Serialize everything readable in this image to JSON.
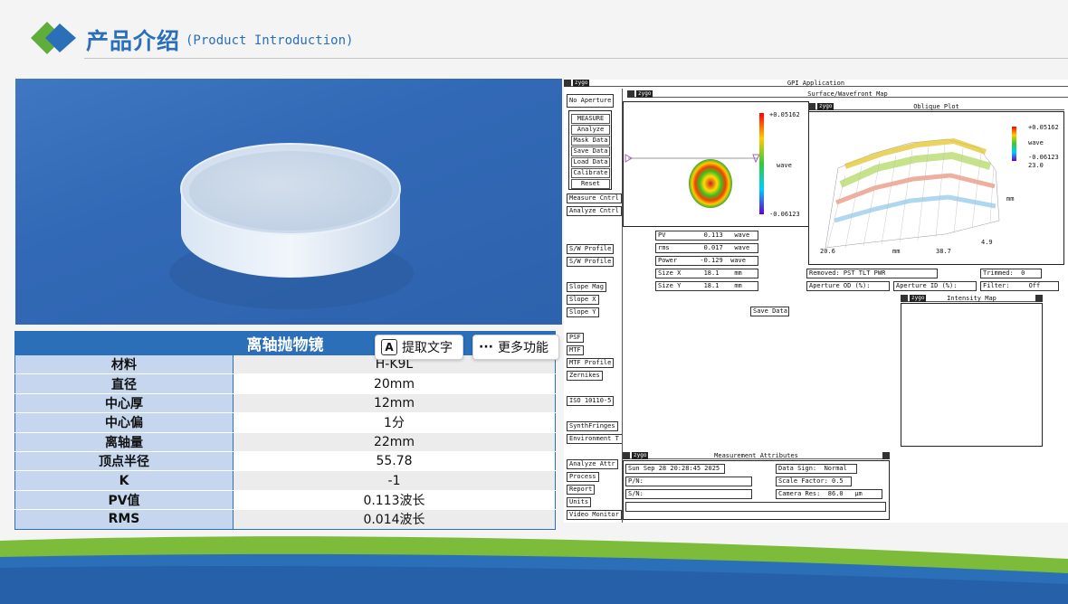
{
  "header": {
    "title": "产品介绍",
    "subtitle": "(Product Introduction)"
  },
  "product_table": {
    "heading": "离轴抛物镜",
    "rows": [
      {
        "key": "材料",
        "value": "H-K9L"
      },
      {
        "key": "直径",
        "value": "20mm"
      },
      {
        "key": "中心厚",
        "value": "12mm"
      },
      {
        "key": "中心偏",
        "value": "1分"
      },
      {
        "key": "离轴量",
        "value": "22mm"
      },
      {
        "key": "顶点半径",
        "value": "55.78"
      },
      {
        "key": "K",
        "value": "-1"
      },
      {
        "key": "PV值",
        "value": "0.113波长"
      },
      {
        "key": "RMS",
        "value": "0.014波长"
      }
    ]
  },
  "overlay": {
    "extract_text_label": "提取文字",
    "extract_text_icon": "text-recognition-icon",
    "more_label": "更多功能",
    "more_icon": "ellipsis-icon"
  },
  "software": {
    "app_title": "GPI Application",
    "brand": "zygo",
    "no_aperture": "No Aperture",
    "measure_buttons": [
      "MEASURE",
      "Analyze",
      "Mask Data",
      "Save Data",
      "Load Data",
      "Calibrate",
      "Reset"
    ],
    "side_buttons": [
      "Measure Cntrl",
      "Analyze Cntrl",
      "S/W Profile",
      "S/W Profile",
      "Slope Mag",
      "Slope X",
      "Slope Y",
      "PSF",
      "MTF",
      "MTF Profile",
      "Zernikes",
      "ISO 10110-5",
      "SynthFringes",
      "Environment T",
      "Analyze Attr",
      "Process",
      "Report",
      "Units",
      "Video Monitor"
    ],
    "surface_window": {
      "title": "Surface/Wavefront Map",
      "scale_max": "+0.05162",
      "scale_min": "-0.06123",
      "scale_unit": "wave"
    },
    "oblique_window": {
      "title": "Oblique Plot",
      "scale_max": "+0.05162",
      "scale_min": "-0.06123",
      "scale_unit": "wave",
      "y_max": "23.0",
      "y_unit": "mm",
      "y_min": "4.9",
      "x_min": "20.6",
      "x_unit": "mm",
      "x_max": "38.7"
    },
    "results": [
      {
        "label": "PV",
        "value": "0.113",
        "unit": "wave"
      },
      {
        "label": "rms",
        "value": "0.017",
        "unit": "wave"
      },
      {
        "label": "Power",
        "value": "-0.129",
        "unit": "wave"
      },
      {
        "label": "Size X",
        "value": "18.1",
        "unit": "mm"
      },
      {
        "label": "Size Y",
        "value": "18.1",
        "unit": "mm"
      }
    ],
    "removed": "Removed: PST TLT PWR",
    "trimmed": "Trimmed:  0",
    "aperture_od": "Aperture OD (%):",
    "aperture_id": "Aperture ID (%):",
    "filter": "Filter:     Off",
    "save_data": "Save Data",
    "intensity_window": {
      "title": "Intensity Map"
    },
    "attributes_window": {
      "title": "Measurement Attributes",
      "date": "Sun Sep 28 20:28:45 2025",
      "pn": "P/N:",
      "sn": "S/N:",
      "data_sign": "Data Sign:  Normal",
      "scale_factor": "Scale Factor: 0.5",
      "camera_res": "Camera Res:  86.0   µm"
    }
  },
  "colors": {
    "brand_blue": "#2a6fb8",
    "logo_green": "#5fae3c",
    "table_key_bg": "#c5d6ee",
    "band_green": "#7dbb3a",
    "band_blue": "#2a6fb8"
  }
}
